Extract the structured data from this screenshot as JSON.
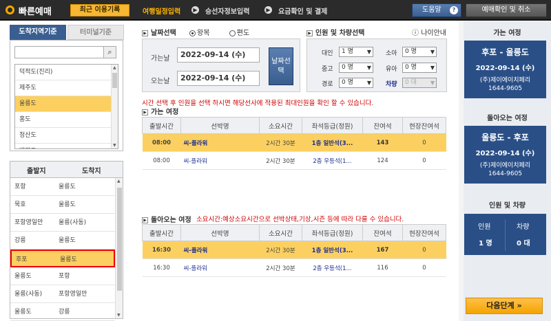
{
  "app": {
    "title": "빠른예매",
    "recent_label": "최근 이용기록"
  },
  "steps": [
    "여행일정입력",
    "승선자정보입력",
    "요금확인 및 결제"
  ],
  "header": {
    "help_label": "도움말",
    "confirm_label": "예매확인 및 취소"
  },
  "region_tabs": {
    "by_area": "도착지역기준",
    "by_terminal": "터미널기준"
  },
  "regions": [
    {
      "name": "덕적도(진리)",
      "selected": false
    },
    {
      "name": "제주도",
      "selected": false
    },
    {
      "name": "울릉도",
      "selected": true
    },
    {
      "name": "홍도",
      "selected": false
    },
    {
      "name": "청산도",
      "selected": false
    },
    {
      "name": "백령도",
      "selected": false
    }
  ],
  "route_head": {
    "departure": "출발지",
    "arrival": "도착지"
  },
  "routes": [
    {
      "from": "포항",
      "to": "울릉도",
      "selected": false
    },
    {
      "from": "묵호",
      "to": "울릉도",
      "selected": false
    },
    {
      "from": "포항영일만",
      "to": "울릉(사동)",
      "selected": false
    },
    {
      "from": "강릉",
      "to": "울릉도",
      "selected": false
    },
    {
      "from": "후포",
      "to": "울릉도",
      "selected": true
    },
    {
      "from": "울릉도",
      "to": "포항",
      "selected": false
    },
    {
      "from": "울릉(사동)",
      "to": "포항영일만",
      "selected": false
    },
    {
      "from": "울릉도",
      "to": "강릉",
      "selected": false
    }
  ],
  "date_section": {
    "title": "날짜선택",
    "round_trip": "왕복",
    "one_way": "편도",
    "go_label": "가는날",
    "go_date": "2022-09-14 (수)",
    "return_label": "오는날",
    "return_date": "2022-09-14 (수)",
    "date_button": "날짜선택"
  },
  "pax_section": {
    "title": "인원 및 차량선택",
    "age_info": "나이안내",
    "adult": "대인",
    "adult_val": "1 명",
    "child": "소아",
    "child_val": "0 명",
    "teen": "중고",
    "teen_val": "0 명",
    "infant": "유아",
    "infant_val": "0 명",
    "senior": "경로",
    "senior_val": "0 명",
    "vehicle": "차량",
    "vehicle_val": "0 대"
  },
  "notice": "시간 선택 후 인원을 선택 하시면 해당선사에 적용된 최대인원을 확인 할 수 있습니다.",
  "go_trip": {
    "title": "가는 여정",
    "headers": [
      "출발시간",
      "선박명",
      "소요시간",
      "좌석등급(정원)",
      "잔여석",
      "현장잔여석"
    ],
    "rows": [
      {
        "time": "08:00",
        "ship": "씨-플라워",
        "duration": "2시간 30분",
        "grade": "1층 일반석(3...",
        "seats": "143",
        "onsite": "0",
        "selected": true
      },
      {
        "time": "08:00",
        "ship": "씨-플라워",
        "duration": "2시간 30분",
        "grade": "2층 우등석(1...",
        "seats": "124",
        "onsite": "0",
        "selected": false
      }
    ]
  },
  "return_trip": {
    "title": "돌아오는 여정",
    "notice": "소요시간:예상소요시간으로 선박상태,기상,시즌 등에 따라 다를 수 있습니다.",
    "headers": [
      "출발시간",
      "선박명",
      "소요시간",
      "좌석등급(정원)",
      "잔여석",
      "현장잔여석"
    ],
    "rows": [
      {
        "time": "16:30",
        "ship": "씨-플라워",
        "duration": "2시간 30분",
        "grade": "1층 일반석(3...",
        "seats": "167",
        "onsite": "0",
        "selected": true
      },
      {
        "time": "16:30",
        "ship": "씨-플라워",
        "duration": "2시간 30분",
        "grade": "2층 우등석(1...",
        "seats": "116",
        "onsite": "0",
        "selected": false
      }
    ]
  },
  "summary": {
    "go_label": "가는 여정",
    "go_route": "후포 - 울릉도",
    "go_date": "2022-09-14 (수)",
    "go_company": "(주)제이에이치페리",
    "go_phone": "1644-9605",
    "return_label": "돌아오는 여정",
    "return_route": "울릉도 - 후포",
    "return_date": "2022-09-14 (수)",
    "return_company": "(주)제이에이치페리",
    "return_phone": "1644-9605",
    "pax_label": "인원 및 차량",
    "pax_head": "인원",
    "vehicle_head": "차량",
    "pax_val": "1 명",
    "vehicle_val": "0 대",
    "next_label": "다음단계 »"
  },
  "colors": {
    "accent": "#f7b733",
    "navy": "#2a4f87",
    "selected_row": "#fcd060",
    "alert": "#d00000"
  }
}
